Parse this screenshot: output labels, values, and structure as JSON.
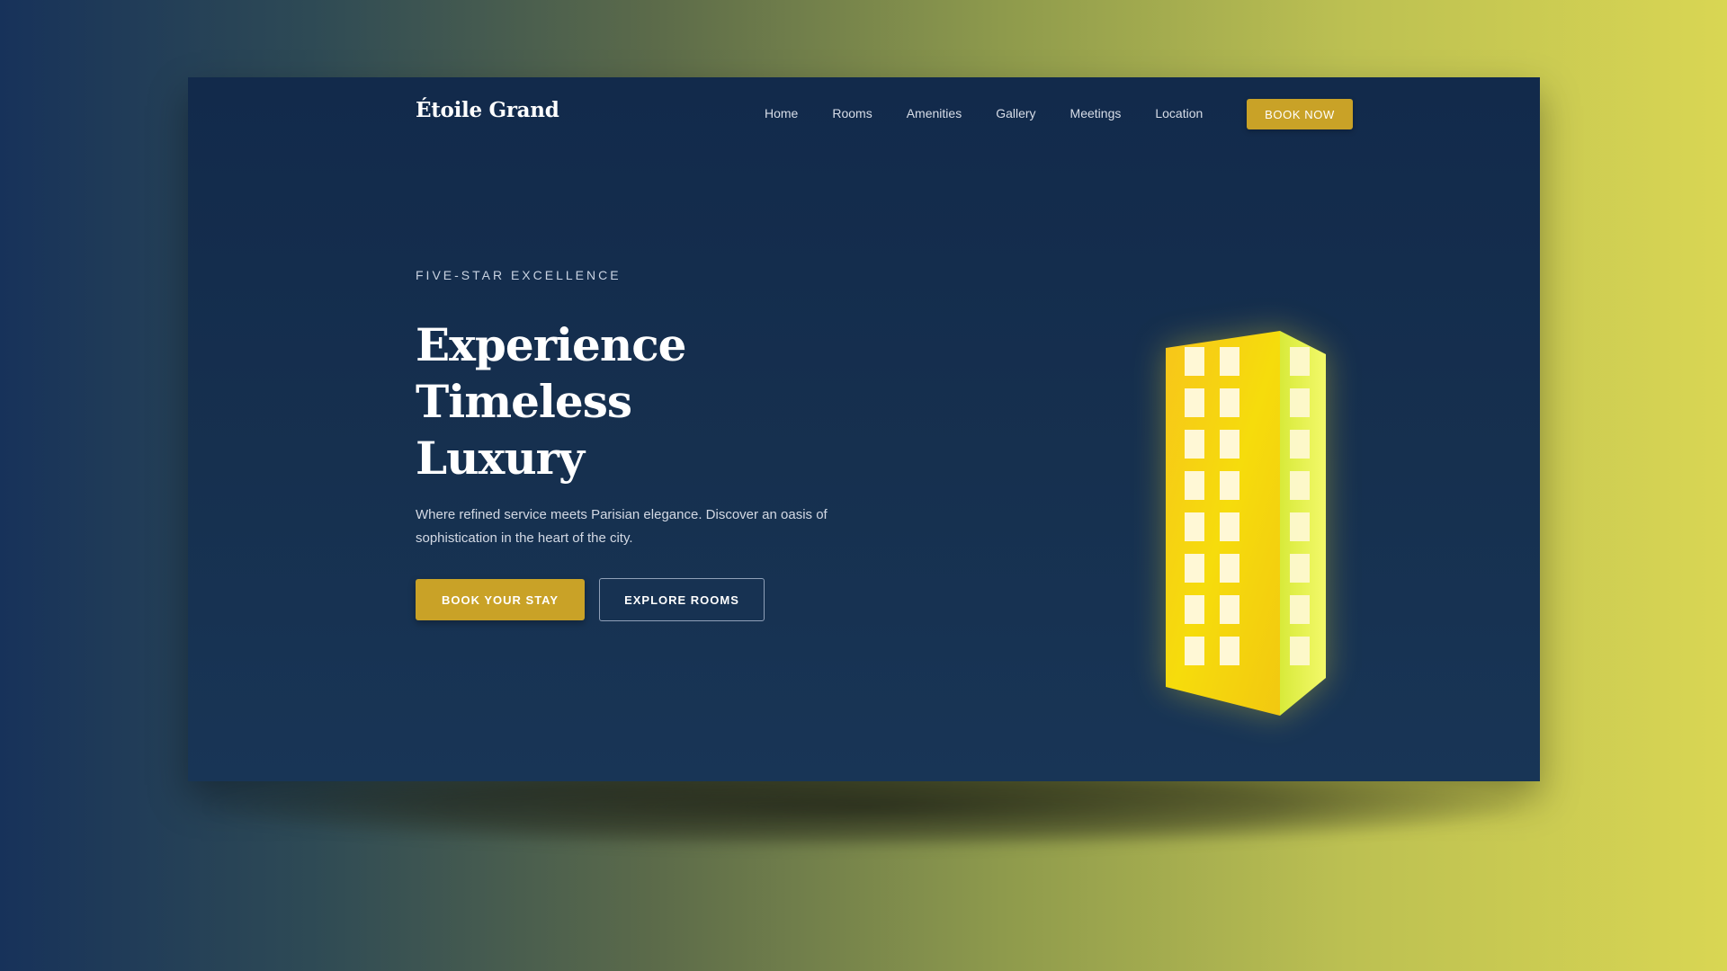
{
  "brand": {
    "name": "Étoile Grand"
  },
  "nav": {
    "items": [
      {
        "label": "Home"
      },
      {
        "label": "Rooms"
      },
      {
        "label": "Amenities"
      },
      {
        "label": "Gallery"
      },
      {
        "label": "Meetings"
      },
      {
        "label": "Location"
      }
    ],
    "cta_label": "BOOK NOW"
  },
  "hero": {
    "eyebrow": "FIVE-STAR EXCELLENCE",
    "headline_lines": [
      "Experience",
      "Timeless",
      "Luxury"
    ],
    "description": "Where refined service meets Parisian elegance. Discover an oasis of sophistication in the heart of the city.",
    "primary_cta": "BOOK YOUR STAY",
    "secondary_cta": "EXPLORE ROOMS"
  },
  "illustration": {
    "icon": "hotel-building-icon",
    "front_color": "#f5d20a",
    "side_color": "#e8f24a",
    "window_color": "#fff8d6"
  },
  "colors": {
    "accent": "#c9a227",
    "card_background": "#16304f",
    "text_primary": "#ffffff"
  }
}
